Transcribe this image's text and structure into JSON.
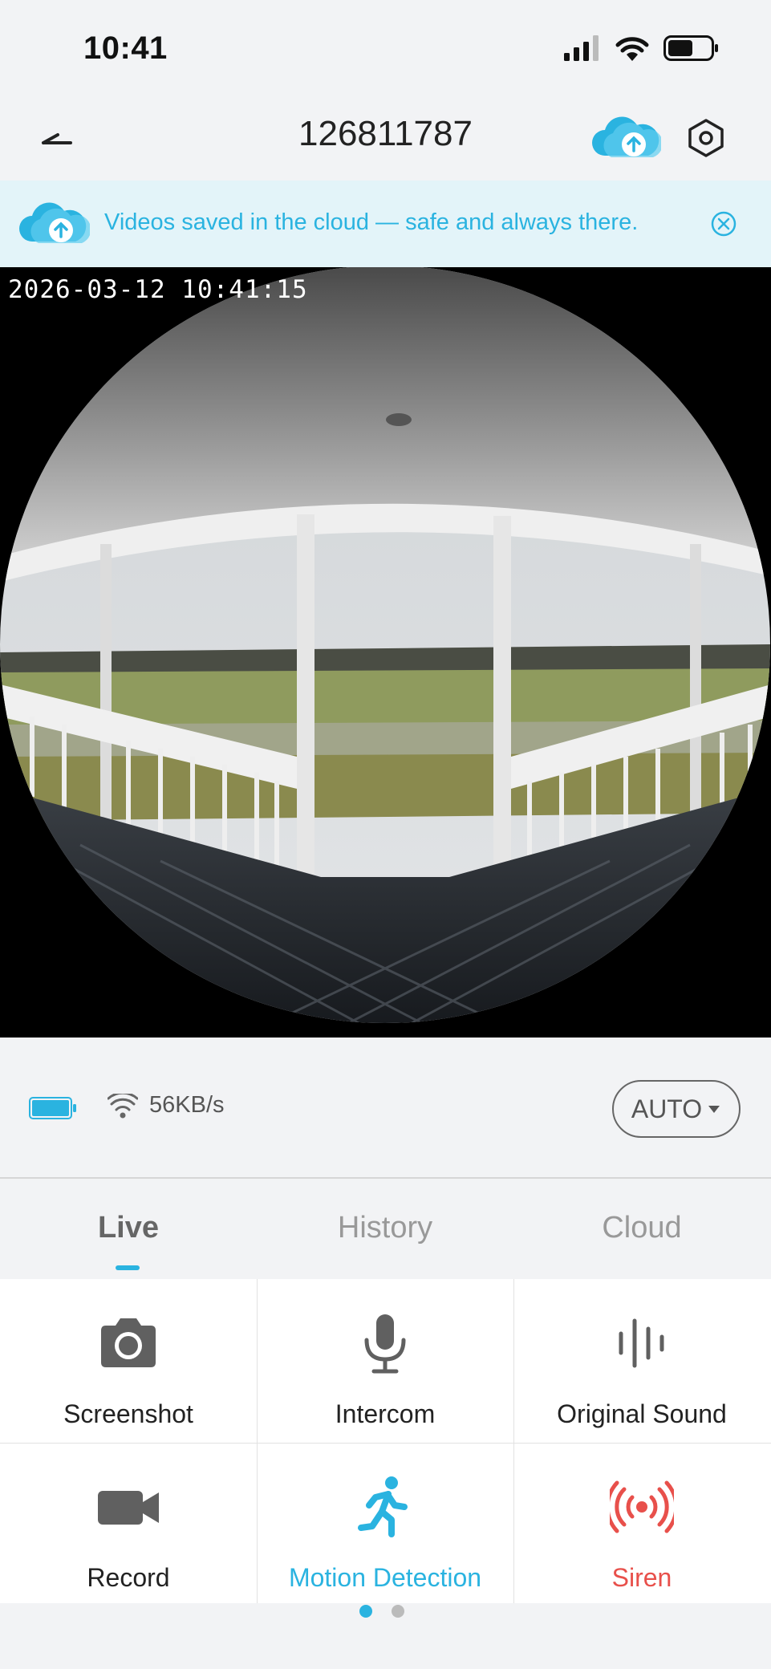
{
  "status": {
    "time": "10:41"
  },
  "header": {
    "title": "126811787"
  },
  "banner": {
    "text": "Videos saved in the cloud — safe and always there."
  },
  "video": {
    "timestamp": "2026-03-12 10:41:15"
  },
  "info": {
    "speed": "56KB/s",
    "quality": "AUTO",
    "battery_level": 1.0
  },
  "tabs": [
    {
      "label": "Live",
      "active": true
    },
    {
      "label": "History",
      "active": false
    },
    {
      "label": "Cloud",
      "active": false
    }
  ],
  "controls": [
    {
      "label": "Screenshot",
      "icon": "camera-icon"
    },
    {
      "label": "Intercom",
      "icon": "microphone-icon"
    },
    {
      "label": "Original Sound",
      "icon": "sound-wave-icon"
    },
    {
      "label": "Record",
      "icon": "video-camera-icon"
    },
    {
      "label": "Motion Detection",
      "icon": "running-person-icon"
    },
    {
      "label": "Siren",
      "icon": "siren-icon"
    }
  ],
  "pager": {
    "pages": 2,
    "current": 1
  },
  "colors": {
    "accent": "#2ab3e0",
    "alert": "#e8504b",
    "banner_bg": "#e3f4f9"
  }
}
